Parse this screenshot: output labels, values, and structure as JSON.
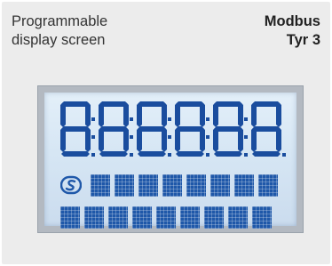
{
  "header": {
    "title_line1": "Programmable",
    "title_line2": "display screen",
    "protocol": "Modbus",
    "model": "Tyr 3"
  },
  "lcd": {
    "digit_count": 6,
    "digit_color": "#1a4d9e",
    "icon": "s-logo-icon",
    "matrix_rows": [
      8,
      9
    ]
  }
}
